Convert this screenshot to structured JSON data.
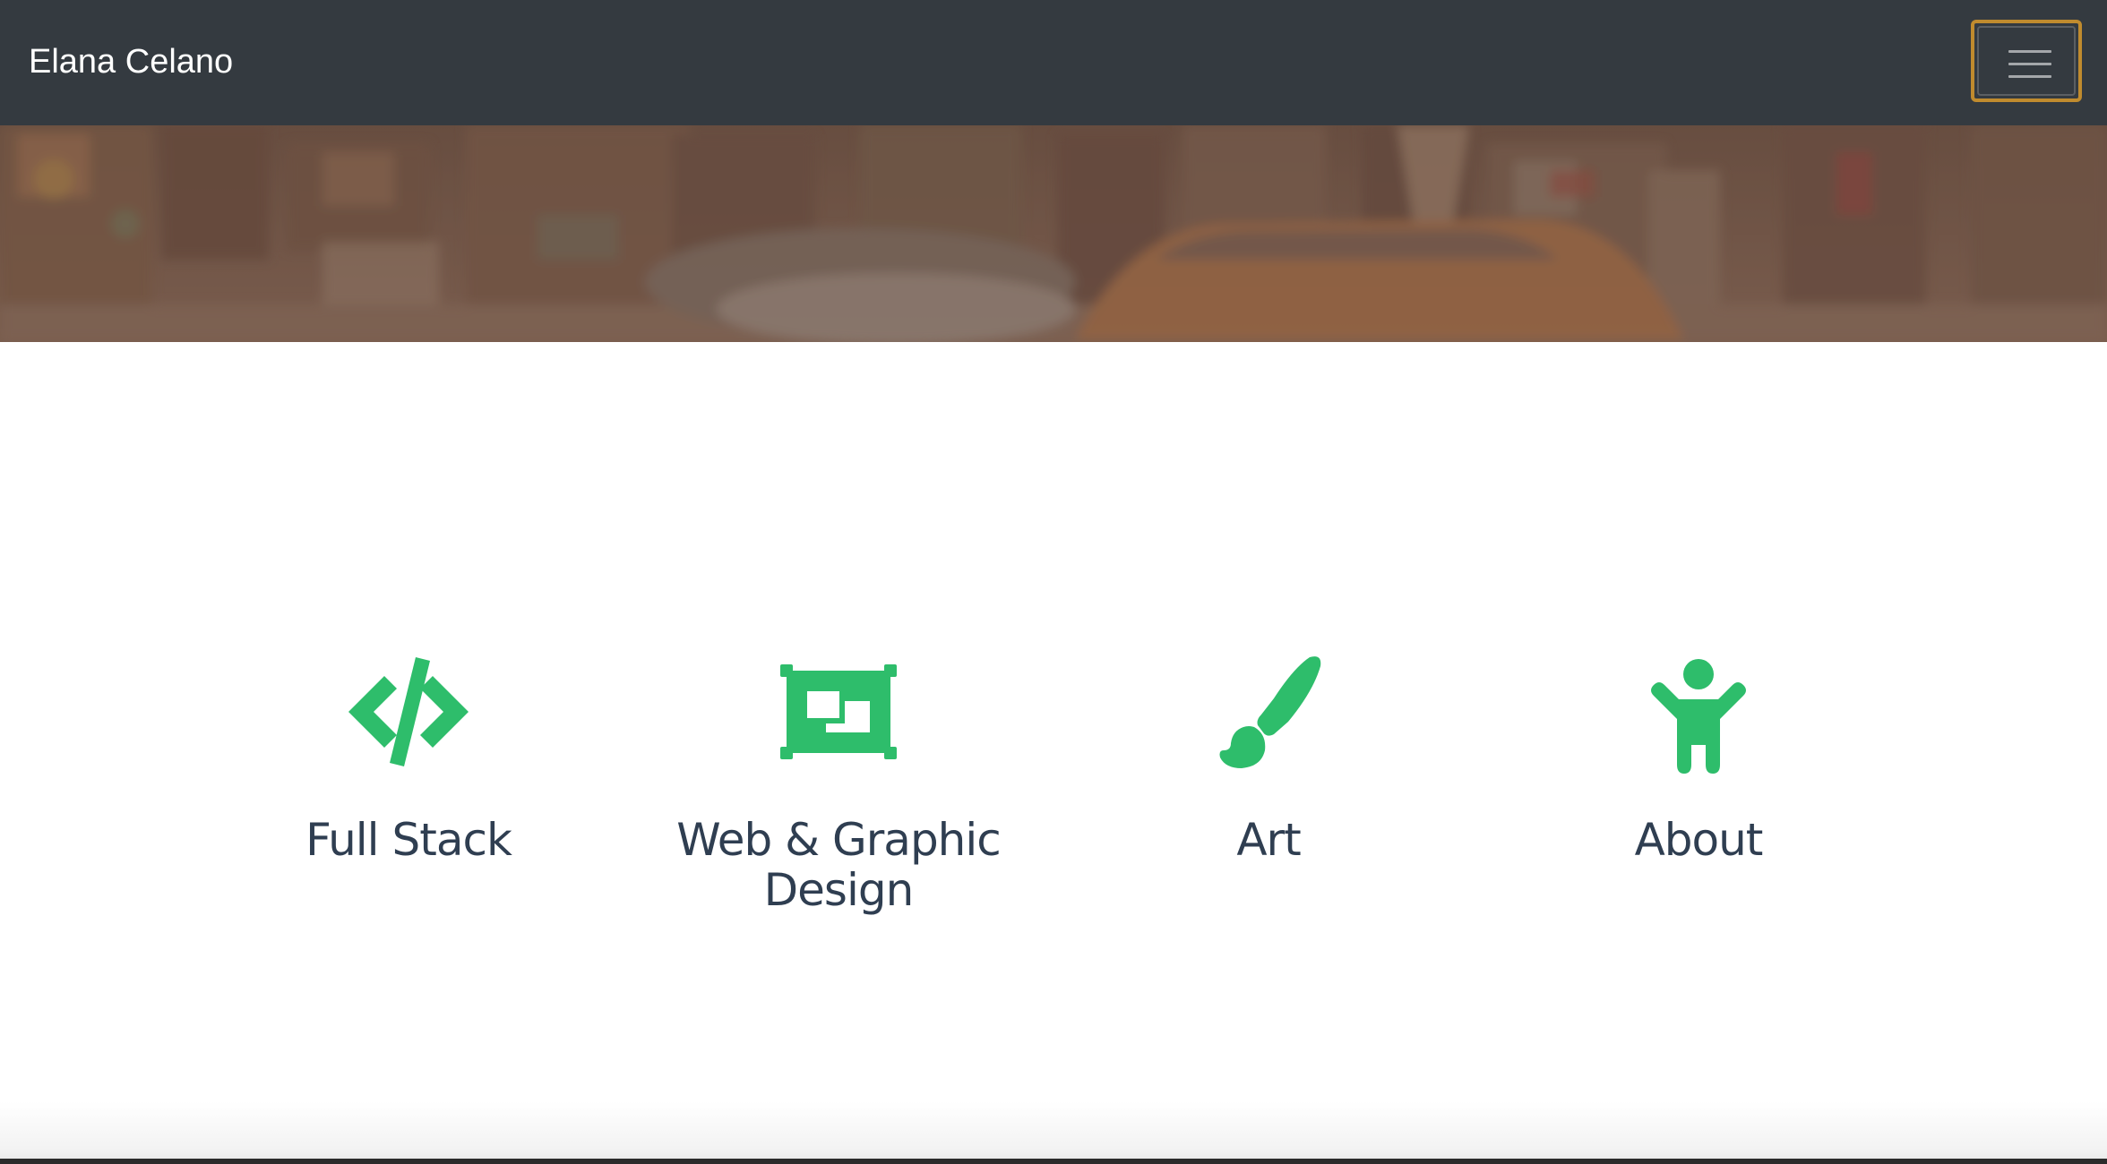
{
  "navbar": {
    "brand": "Elana Celano",
    "menu_icon": "hamburger-menu-icon",
    "toggler_border_color": "#c08b2e",
    "background_color": "#343a40"
  },
  "hero": {
    "image": "blurred-city-street-taxi-photo"
  },
  "features": [
    {
      "label": "Full Stack",
      "icon": "code-icon"
    },
    {
      "label": "Web & Graphic Design",
      "icon": "object-group-icon"
    },
    {
      "label": "Art",
      "icon": "paint-brush-icon"
    },
    {
      "label": "About",
      "icon": "child-icon"
    }
  ],
  "colors": {
    "accent": "#2ebd6b",
    "label_text": "#2f3e51"
  }
}
